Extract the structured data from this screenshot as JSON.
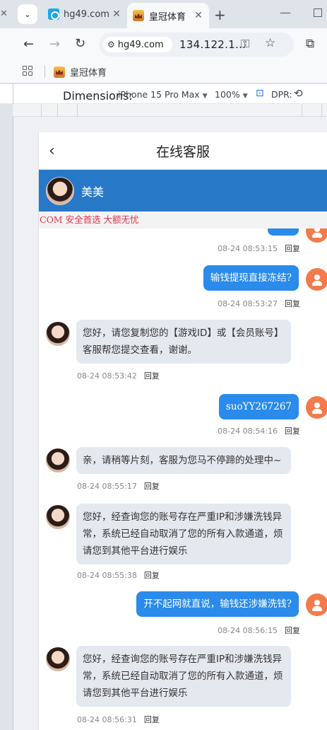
{
  "browser": {
    "tabs": [
      {
        "title": "hg49.com",
        "active": false
      },
      {
        "title": "皇冠体育",
        "active": true
      }
    ],
    "site_info_label": "hg49.com",
    "url": "134.122.1...",
    "bookmark": "皇冠体育"
  },
  "devtools": {
    "dimensions_label": "Dimensions:",
    "device": "iPhone 15 Pro Max",
    "zoom": "100%",
    "dpr_label": "DPR:"
  },
  "page": {
    "header_title": "在线客服",
    "agent_name": "美美",
    "notice": "COM 安全首选 大额无忧",
    "reply_label": "回复",
    "messages": [
      {
        "from": "me",
        "text": "",
        "time": "08-24 08:53:15"
      },
      {
        "from": "me",
        "text": "输钱提现直接冻结?",
        "time": "08-24 08:53:27"
      },
      {
        "from": "agent",
        "text": "您好，请您复制您的【游戏ID】或【会员账号】客服帮您提交查看，谢谢。",
        "time": "08-24 08:53:42"
      },
      {
        "from": "me",
        "text": "suoYY267267",
        "time": "08-24 08:54:16"
      },
      {
        "from": "agent",
        "text": "亲，请稍等片刻，客服为您马不停蹄的处理中~",
        "time": "08-24 08:55:17"
      },
      {
        "from": "agent",
        "text": "您好，经查询您的账号存在严重IP和涉嫌洗钱异常，系统已经自动取消了您的所有入款通道，烦请您到其他平台进行娱乐",
        "time": "08-24 08:55:38"
      },
      {
        "from": "me",
        "text": "开不起网就直说，输钱还涉嫌洗钱?",
        "time": "08-24 08:56:15"
      },
      {
        "from": "agent",
        "text": "您好，经查询您的账号存在严重IP和涉嫌洗钱异常，系统已经自动取消了您的所有入款通道，烦请您到其他平台进行娱乐",
        "time": "08-24 08:56:31"
      }
    ]
  }
}
